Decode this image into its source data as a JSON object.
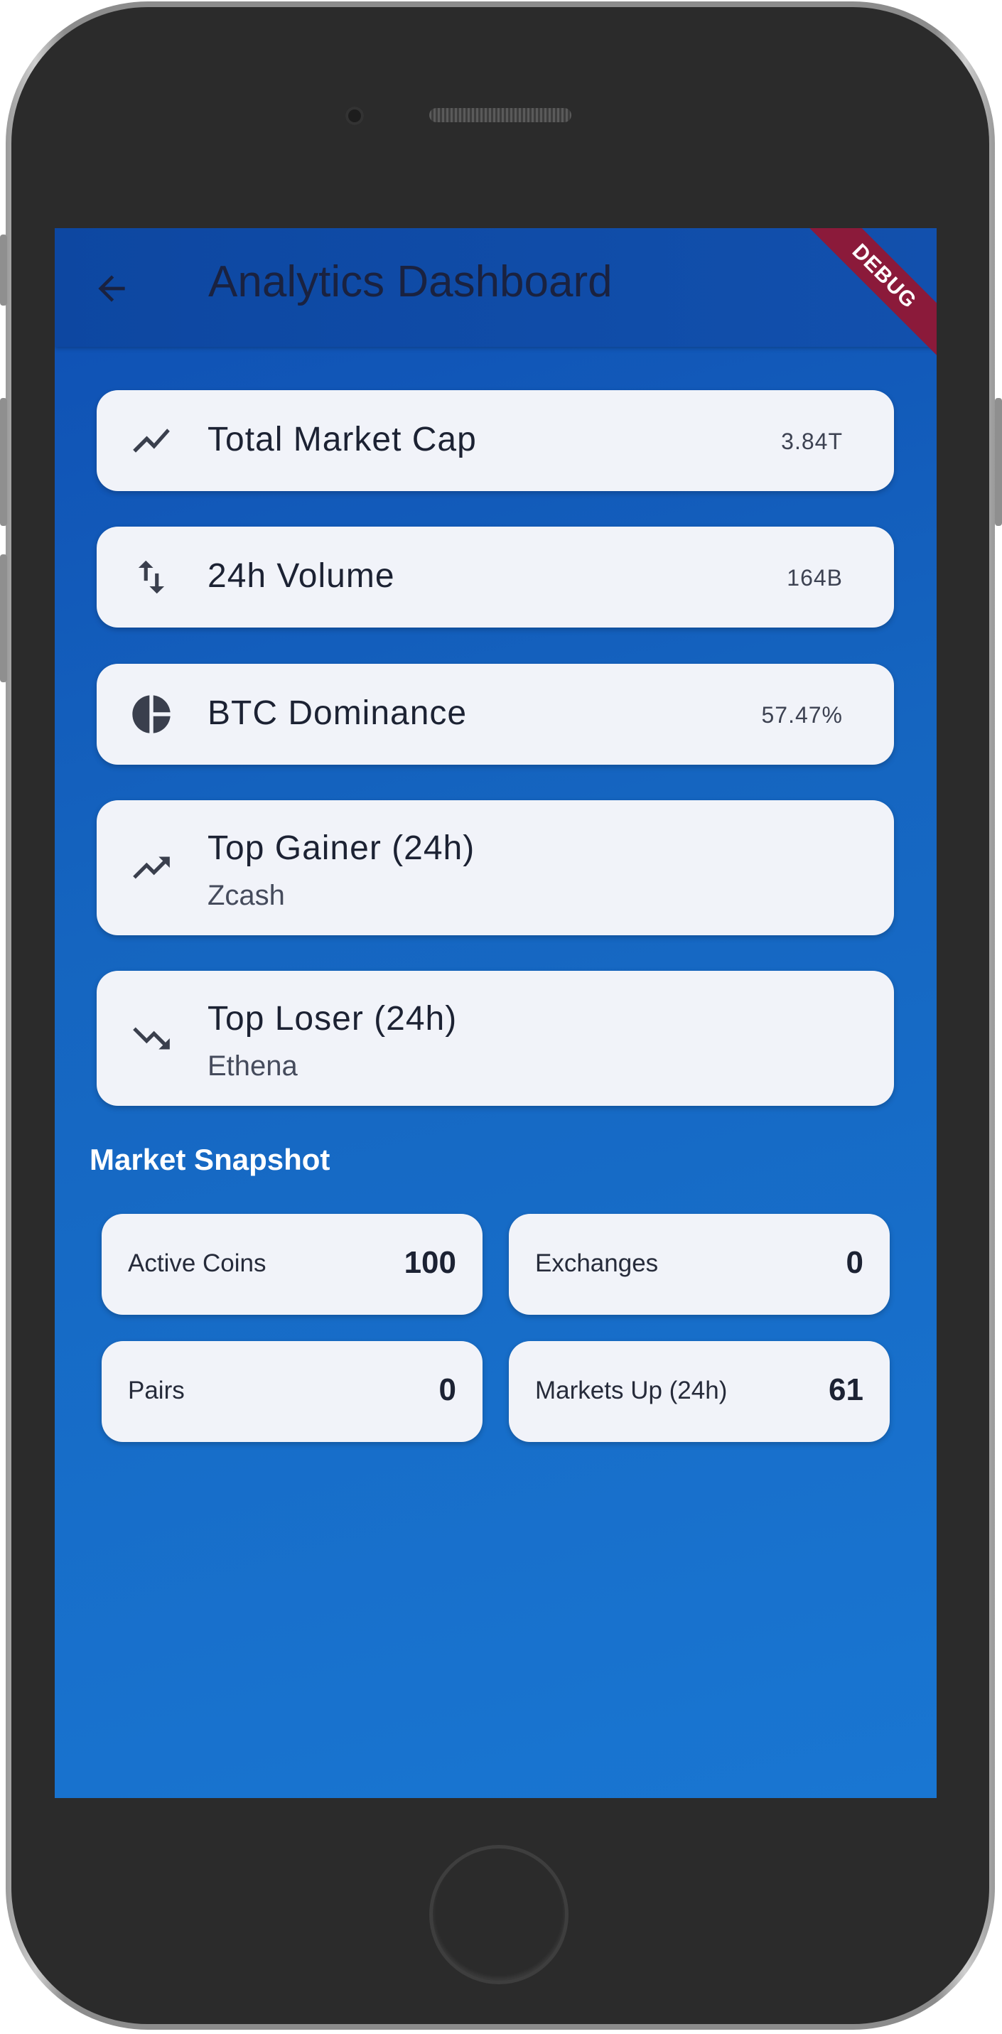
{
  "appbar": {
    "title": "Analytics Dashboard",
    "back_icon": "arrow-back-icon",
    "debug_banner": "DEBUG"
  },
  "stats": [
    {
      "icon": "trending-line-icon",
      "title": "Total Market Cap",
      "value": "3.84T"
    },
    {
      "icon": "swap-vert-icon",
      "title": "24h Volume",
      "value": "164B"
    },
    {
      "icon": "pie-chart-icon",
      "title": "BTC Dominance",
      "value": "57.47%"
    },
    {
      "icon": "trending-up-icon",
      "title": "Top Gainer (24h)",
      "subtitle": "Zcash"
    },
    {
      "icon": "trending-down-icon",
      "title": "Top Loser (24h)",
      "subtitle": "Ethena"
    }
  ],
  "snapshot": {
    "title": "Market Snapshot",
    "tiles": [
      {
        "label": "Active Coins",
        "value": "100"
      },
      {
        "label": "Exchanges",
        "value": "0"
      },
      {
        "label": "Pairs",
        "value": "0"
      },
      {
        "label": "Markets Up (24h)",
        "value": "61"
      }
    ]
  },
  "colors": {
    "background": "#1565c0",
    "appbar": "#0d47a1",
    "card": "#f1f3f9",
    "debug_ribbon": "#8b1a3a"
  }
}
